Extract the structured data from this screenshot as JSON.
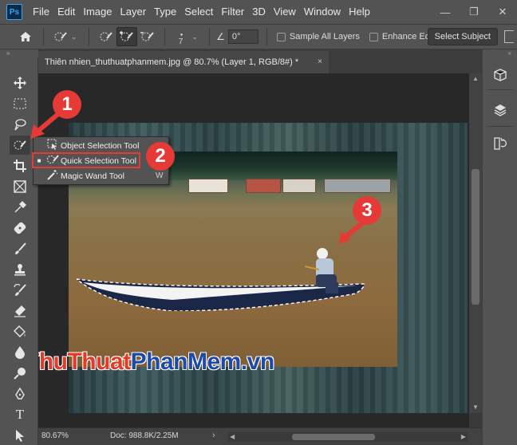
{
  "app": {
    "logo": "Ps",
    "menu": [
      "File",
      "Edit",
      "Image",
      "Layer",
      "Type",
      "Select",
      "Filter",
      "3D",
      "View",
      "Window",
      "Help"
    ],
    "window_controls": [
      "minimize",
      "maximize",
      "close"
    ]
  },
  "options": {
    "brush_size": "7",
    "angle": "0°",
    "sample_all_layers": "Sample All Layers",
    "enhance_edge": "Enhance Edge",
    "select_subject": "Select Subject"
  },
  "document": {
    "tab_title": "Thiên nhien_thuthuatphanmem.jpg @ 80.7% (Layer 1, RGB/8#) *",
    "close": "×"
  },
  "flyout": {
    "items": [
      {
        "label": "Object Selection Tool",
        "key": "",
        "icon": "object-selection-icon"
      },
      {
        "label": "Quick Selection Tool",
        "key": "",
        "icon": "quick-selection-icon",
        "active": true
      },
      {
        "label": "Magic Wand Tool",
        "key": "W",
        "icon": "magic-wand-icon"
      }
    ]
  },
  "annotations": {
    "step1": "1",
    "step2": "2",
    "step3": "3",
    "color": "#e53a36"
  },
  "watermark": {
    "part1": "ThuThuat",
    "part2": "PhanMem",
    "part3": ".vn"
  },
  "status": {
    "zoom": "80.67%",
    "doc": "Doc: 988.8K/2.25M",
    "arrow": "›"
  },
  "toolbar_icons": [
    "move-icon",
    "marquee-icon",
    "lasso-icon",
    "quick-selection-icon",
    "crop-icon",
    "frame-icon",
    "eyedropper-icon",
    "healing-brush-icon",
    "brush-icon",
    "clone-stamp-icon",
    "history-brush-icon",
    "eraser-icon",
    "paint-bucket-icon",
    "blur-icon",
    "dodge-icon",
    "pen-icon",
    "type-icon",
    "path-selection-icon"
  ],
  "right_panel_icons": [
    "3d-icon",
    "layers-icon",
    "history-icon"
  ]
}
